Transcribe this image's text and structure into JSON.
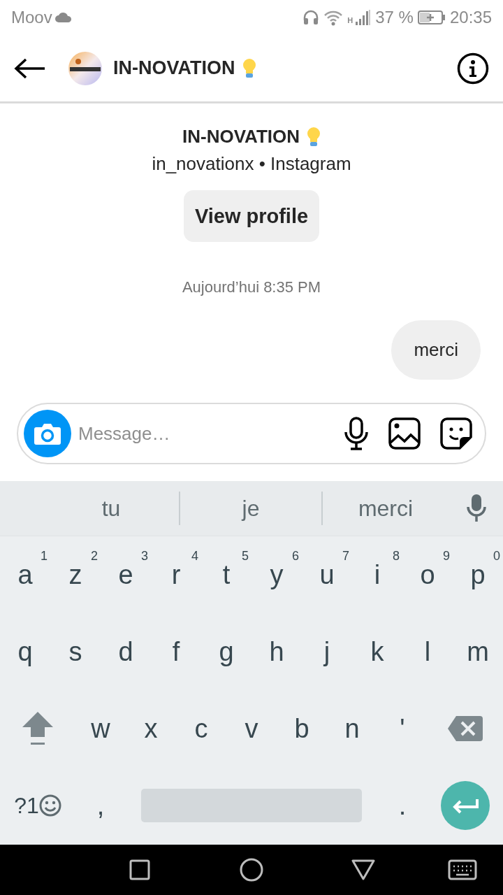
{
  "status_bar": {
    "carrier": "Moov",
    "network": "H",
    "battery": "37 %",
    "time": "20:35"
  },
  "header": {
    "title": "IN-NOVATION"
  },
  "profile": {
    "name": "IN-NOVATION",
    "subtitle": "in_novationx • Instagram",
    "button": "View profile"
  },
  "thread": {
    "timestamp": "Aujourd’hui 8:35 PM",
    "messages": [
      {
        "text": "merci",
        "kind": "sent"
      }
    ]
  },
  "composer": {
    "placeholder": "Message…"
  },
  "keyboard": {
    "suggestions": [
      "tu",
      "je",
      "merci"
    ],
    "rows": [
      [
        {
          "kind": "letter",
          "label": "a",
          "hint": "1"
        },
        {
          "kind": "letter",
          "label": "z",
          "hint": "2"
        },
        {
          "kind": "letter",
          "label": "e",
          "hint": "3"
        },
        {
          "kind": "letter",
          "label": "r",
          "hint": "4"
        },
        {
          "kind": "letter",
          "label": "t",
          "hint": "5"
        },
        {
          "kind": "letter",
          "label": "y",
          "hint": "6"
        },
        {
          "kind": "letter",
          "label": "u",
          "hint": "7"
        },
        {
          "kind": "letter",
          "label": "i",
          "hint": "8"
        },
        {
          "kind": "letter",
          "label": "o",
          "hint": "9"
        },
        {
          "kind": "letter",
          "label": "p",
          "hint": "0"
        }
      ],
      [
        {
          "kind": "letter",
          "label": "q"
        },
        {
          "kind": "letter",
          "label": "s"
        },
        {
          "kind": "letter",
          "label": "d"
        },
        {
          "kind": "letter",
          "label": "f"
        },
        {
          "kind": "letter",
          "label": "g"
        },
        {
          "kind": "letter",
          "label": "h"
        },
        {
          "kind": "letter",
          "label": "j"
        },
        {
          "kind": "letter",
          "label": "k"
        },
        {
          "kind": "letter",
          "label": "l"
        },
        {
          "kind": "letter",
          "label": "m"
        }
      ],
      [
        {
          "kind": "shift"
        },
        {
          "kind": "letter",
          "label": "w"
        },
        {
          "kind": "letter",
          "label": "x"
        },
        {
          "kind": "letter",
          "label": "c"
        },
        {
          "kind": "letter",
          "label": "v"
        },
        {
          "kind": "letter",
          "label": "b"
        },
        {
          "kind": "letter",
          "label": "n"
        },
        {
          "kind": "letter",
          "label": "'"
        },
        {
          "kind": "backspace"
        }
      ],
      [
        {
          "kind": "symbols",
          "label": "?1"
        },
        {
          "kind": "letter",
          "label": ","
        },
        {
          "kind": "space"
        },
        {
          "kind": "letter",
          "label": "."
        },
        {
          "kind": "enter"
        }
      ]
    ]
  }
}
